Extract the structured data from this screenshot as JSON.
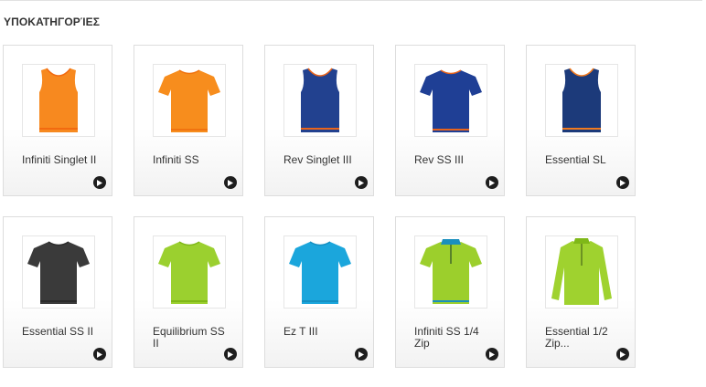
{
  "section": {
    "title": "ΥΠΟΚΑΤΗΓΟΡΊΕΣ"
  },
  "products": [
    {
      "name": "Infiniti Singlet II",
      "color": "#f7891f",
      "trim": "#f26a10",
      "style": "singlet",
      "icon": "singlet-icon"
    },
    {
      "name": "Infiniti SS",
      "color": "#f78d1d",
      "trim": "#f07310",
      "style": "tee",
      "icon": "tshirt-icon"
    },
    {
      "name": "Rev Singlet III",
      "color": "#22418f",
      "trim": "#e8641c",
      "style": "singlet",
      "icon": "singlet-icon"
    },
    {
      "name": "Rev SS III",
      "color": "#1f3f95",
      "trim": "#e8641c",
      "style": "tee",
      "icon": "tshirt-icon"
    },
    {
      "name": "Essential SL",
      "color": "#1c3a7a",
      "trim": "#f07a20",
      "style": "singlet",
      "icon": "singlet-icon"
    },
    {
      "name": "Essential SS II",
      "color": "#3a3a3a",
      "trim": "#2a2a2a",
      "style": "tee",
      "icon": "tshirt-icon"
    },
    {
      "name": "Equilibrium SS II",
      "color": "#9bd02f",
      "trim": "#7fb818",
      "style": "tee",
      "icon": "tshirt-icon"
    },
    {
      "name": "Ez T III",
      "color": "#1ba6dc",
      "trim": "#148fc2",
      "style": "tee",
      "icon": "tshirt-icon"
    },
    {
      "name": "Infiniti SS 1/4 Zip",
      "color": "#9ccf2c",
      "trim": "#1a8fbd",
      "style": "zip",
      "icon": "zip-shirt-icon"
    },
    {
      "name": "Essential 1/2 Zip...",
      "color": "#9fd22f",
      "trim": "#7fb818",
      "style": "longsleeve",
      "icon": "long-sleeve-icon"
    }
  ]
}
